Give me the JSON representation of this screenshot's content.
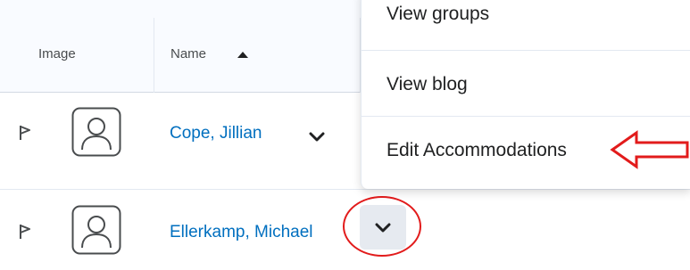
{
  "table": {
    "columns": {
      "image": "Image",
      "name": "Name"
    },
    "rows": [
      {
        "name": "Cope, Jillian"
      },
      {
        "name": "Ellerkamp, Michael"
      }
    ]
  },
  "menu": {
    "items": [
      "View groups",
      "View blog",
      "Edit Accommodations"
    ]
  },
  "icons": {
    "sort": "sort-ascending-icon",
    "flag": "flag-icon",
    "avatar": "user-avatar-icon",
    "chevron": "chevron-down-icon"
  },
  "colors": {
    "link": "#006fbf",
    "annotation": "#e21b1b"
  }
}
